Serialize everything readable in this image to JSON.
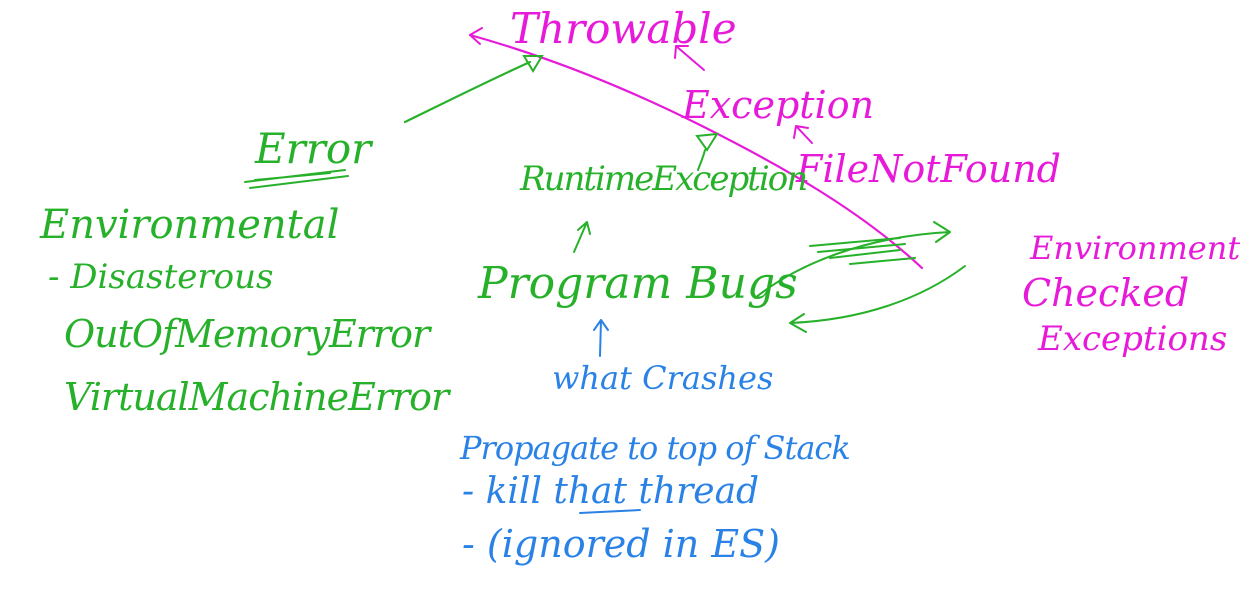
{
  "colors": {
    "magenta": "#e61ad8",
    "green": "#27b12a",
    "blue": "#2a82e6"
  },
  "hierarchy": {
    "throwable": "Throwable",
    "exception": "Exception",
    "file_not_found": "FileNotFound",
    "error": "Error",
    "runtime_exception": "RuntimeException"
  },
  "error_notes": {
    "heading": "Environmental",
    "line1": "- Disasterous",
    "line2": "OutOfMemoryError",
    "line3": "VirtualMachineError"
  },
  "center_notes": {
    "program_bugs": "Program Bugs",
    "what_crashes": "what Crashes",
    "propagate": "Propagate to top of Stack",
    "kill_thread": "- kill that thread",
    "ignored": "- (ignored in ES)"
  },
  "checked_notes": {
    "line1": "Environmental",
    "line2": "Checked",
    "line3": "Exceptions"
  }
}
